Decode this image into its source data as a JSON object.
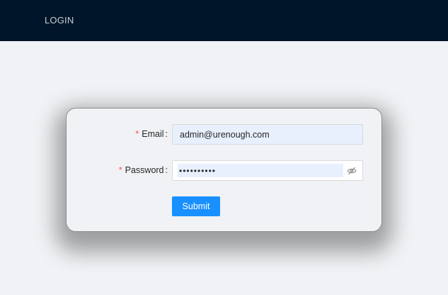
{
  "header": {
    "nav_login": "LOGIN"
  },
  "form": {
    "email": {
      "required_mark": "*",
      "label": "Email",
      "colon": ":",
      "value": "admin@urenough.com"
    },
    "password": {
      "required_mark": "*",
      "label": "Password",
      "colon": ":",
      "value": "••••••••••"
    },
    "submit_label": "Submit"
  },
  "colors": {
    "header_bg": "#001529",
    "primary": "#1890ff",
    "autofill_bg": "#e8f0fe",
    "required": "#ff4d4f"
  },
  "icons": {
    "password_toggle": "eye-invisible-icon"
  }
}
